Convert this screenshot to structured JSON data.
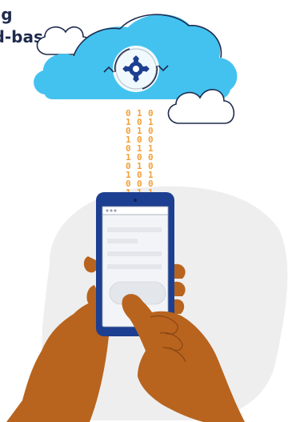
{
  "heading": {
    "line1": "Using",
    "line2": "Cloud-based"
  },
  "cloud": {
    "fill": "#43c2f0",
    "outline": "#1f2b4d",
    "icon": "gear-sync-icon"
  },
  "binary": {
    "color": "#f2a03a",
    "columns": [
      "0101010101",
      "1010101001",
      "0100100101"
    ]
  },
  "phone": {
    "frame_color": "#1d3f91",
    "screen_color": "#f2f4f7",
    "button_color": "#e3e6ea"
  },
  "colors": {
    "skin": "#b8641e",
    "skin_shadow": "#8f4814",
    "blob": "#eeeeef",
    "binary": "#f2a03a"
  }
}
